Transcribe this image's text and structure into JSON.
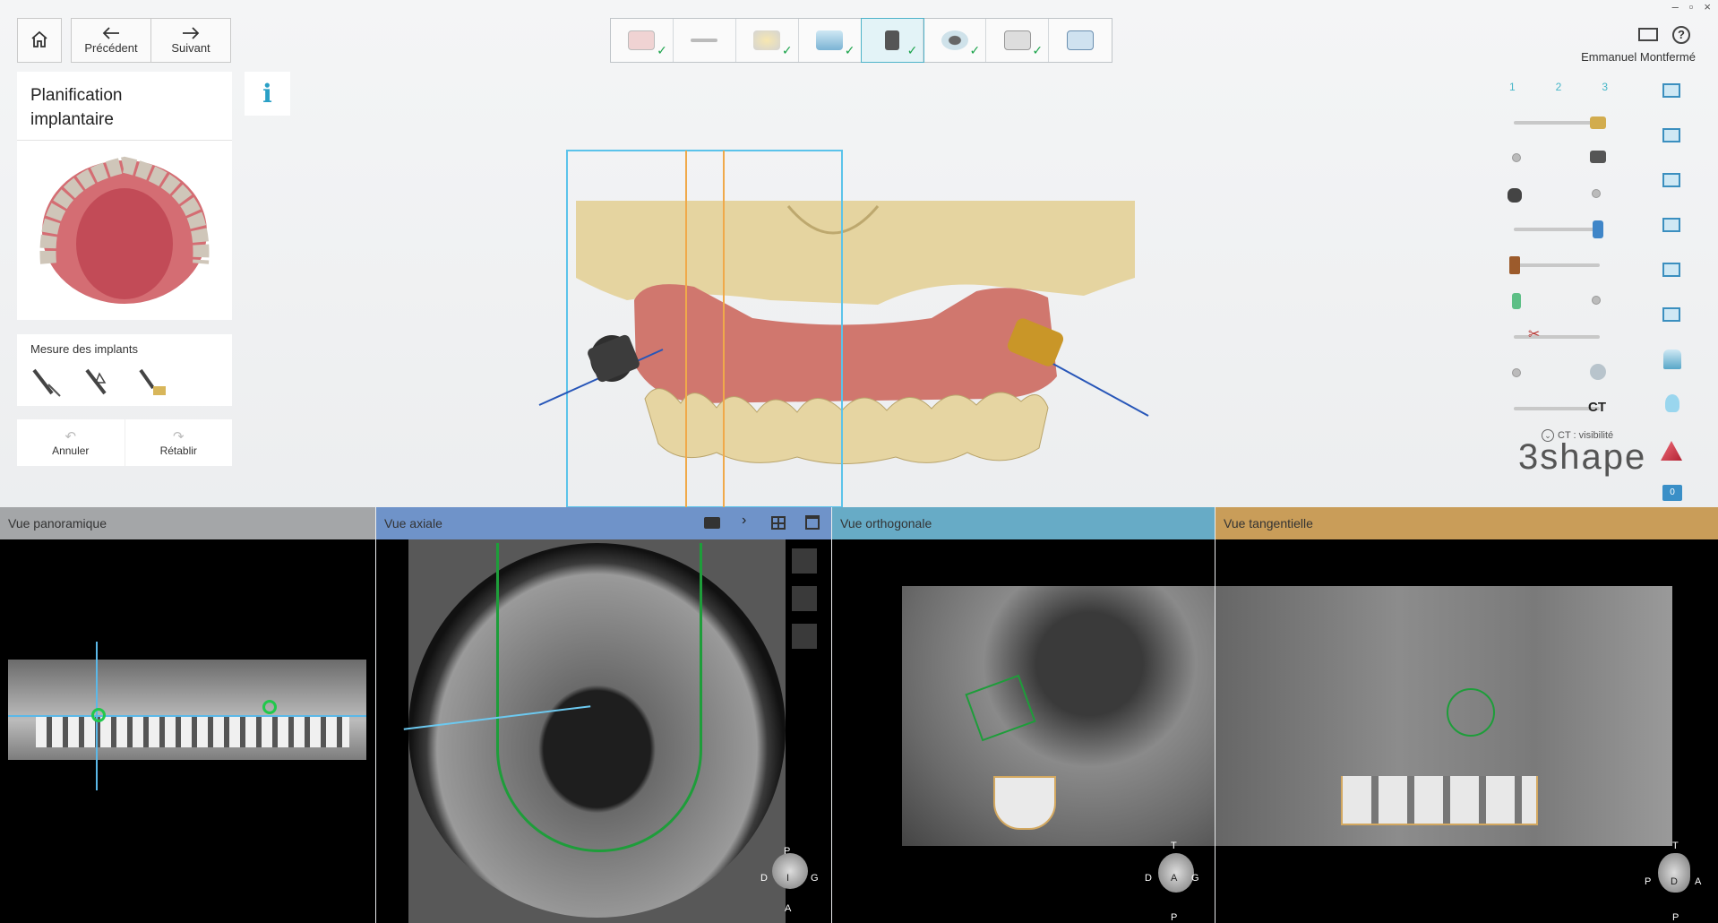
{
  "window_controls": {
    "minimize": "–",
    "maximize": "▫",
    "close": "×"
  },
  "nav": {
    "prev_label": "Précédent",
    "next_label": "Suivant"
  },
  "workflow": {
    "steps": [
      {
        "icon": "prescription-icon",
        "done": true
      },
      {
        "icon": "instrument-icon",
        "done": false
      },
      {
        "icon": "scan-icon",
        "done": true
      },
      {
        "icon": "alignment-icon",
        "done": true
      },
      {
        "icon": "implant-planning-icon",
        "done": true
      },
      {
        "icon": "view-icon",
        "done": true
      },
      {
        "icon": "guide-icon",
        "done": true
      },
      {
        "icon": "export-icon",
        "done": false
      }
    ],
    "active_index": 4
  },
  "user": {
    "name": "Emmanuel Montfermé"
  },
  "left": {
    "title": "Planification implantaire",
    "measure_label": "Mesure des implants",
    "undo_label": "Annuler",
    "redo_label": "Rétablir"
  },
  "right_toolbar": {
    "columns": [
      "1",
      "2",
      "3"
    ],
    "ct_label": "CT",
    "ct_visibility": "CT : visibilité",
    "badge": "0"
  },
  "brand": {
    "logo": "3shape"
  },
  "panels": [
    {
      "title": "Vue panoramique",
      "color": "#a4a6a8"
    },
    {
      "title": "Vue axiale",
      "color": "#6f93c9"
    },
    {
      "title": "Vue orthogonale",
      "color": "#67abc6"
    },
    {
      "title": "Vue tangentielle",
      "color": "#c99d59"
    }
  ],
  "orient": {
    "axial": {
      "top": "P",
      "left": "D",
      "center": "I",
      "right": "G",
      "bottom": "A"
    },
    "ortho": {
      "top": "T",
      "left": "D",
      "center": "A",
      "right": "G",
      "bottom": "P"
    },
    "tang": {
      "top": "T",
      "left": "P",
      "center": "D",
      "right": "A",
      "bottom": "P"
    }
  }
}
